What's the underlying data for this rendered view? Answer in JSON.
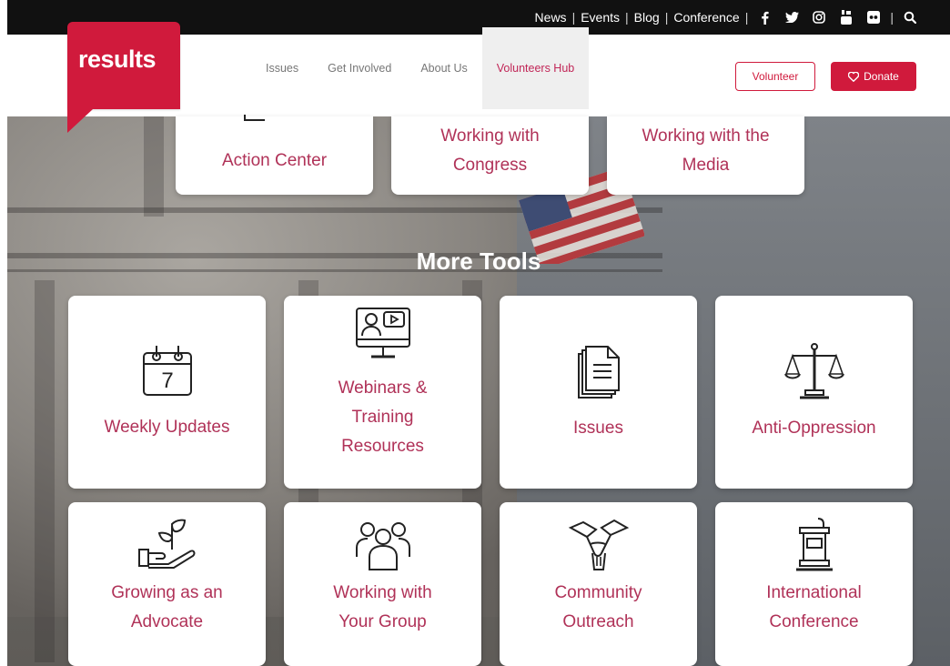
{
  "topbar": {
    "links": [
      "News",
      "Events",
      "Blog",
      "Conference"
    ],
    "icons": [
      "facebook-icon",
      "twitter-icon",
      "instagram-icon",
      "youtube-icon",
      "flickr-icon",
      "search-icon"
    ]
  },
  "header": {
    "logo_text": "results",
    "menu": [
      "Issues",
      "Get Involved",
      "About Us",
      "Volunteers Hub"
    ],
    "volunteer_label": "Volunteer",
    "donate_label": "Donate"
  },
  "top_cards": [
    {
      "label": "Action Center"
    },
    {
      "label": "Working with Congress"
    },
    {
      "label": "Working with the Media"
    }
  ],
  "more_tools": {
    "title": "More Tools",
    "cards": [
      {
        "label": "Weekly Updates",
        "icon": "calendar-icon"
      },
      {
        "label": "Webinars & Training Resources",
        "icon": "webinar-monitor-icon"
      },
      {
        "label": "Issues",
        "icon": "documents-icon"
      },
      {
        "label": "Anti-Oppression",
        "icon": "scales-icon"
      },
      {
        "label": "Growing as an Advocate",
        "icon": "hand-sprout-icon"
      },
      {
        "label": "Working with Your Group",
        "icon": "group-people-icon"
      },
      {
        "label": "Community Outreach",
        "icon": "joined-hands-icon"
      },
      {
        "label": "International Conference",
        "icon": "podium-icon"
      }
    ]
  },
  "colors": {
    "brand_red": "#d01a3c",
    "label_color": "#b03258",
    "topbar_bg": "#111111"
  }
}
